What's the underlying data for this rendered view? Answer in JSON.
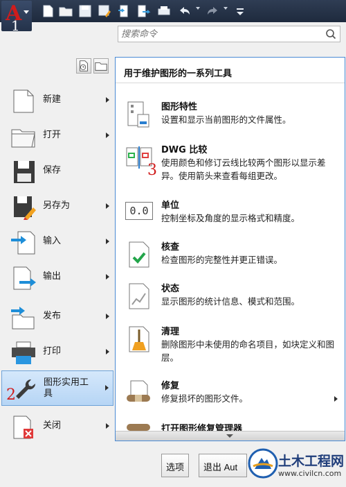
{
  "app_button": {
    "marker": "1"
  },
  "search": {
    "placeholder": "搜索命令"
  },
  "menu": {
    "items": [
      {
        "label": "新建",
        "has_arrow": true
      },
      {
        "label": "打开",
        "has_arrow": true
      },
      {
        "label": "保存",
        "has_arrow": false
      },
      {
        "label": "另存为",
        "has_arrow": true
      },
      {
        "label": "输入",
        "has_arrow": true
      },
      {
        "label": "输出",
        "has_arrow": true
      },
      {
        "label": "发布",
        "has_arrow": true
      },
      {
        "label": "打印",
        "has_arrow": true
      },
      {
        "label": "图形实用工具",
        "label_line1": "图形实用工",
        "label_line2": "具",
        "has_arrow": true,
        "active": true,
        "marker": "2"
      },
      {
        "label": "关闭",
        "has_arrow": true
      }
    ]
  },
  "submenu": {
    "title": "用于维护图形的一系列工具",
    "items": [
      {
        "title": "图形特性",
        "desc": "设置和显示当前图形的文件属性。"
      },
      {
        "title": "DWG 比较",
        "desc": "使用颜色和修订云线比较两个图形以显示差异。使用箭头来查看每组更改。",
        "marker": "3"
      },
      {
        "title": "单位",
        "desc": "控制坐标及角度的显示格式和精度。",
        "icon_text": "0.0"
      },
      {
        "title": "核查",
        "desc": "检查图形的完整性并更正错误。"
      },
      {
        "title": "状态",
        "desc": "显示图形的统计信息、模式和范围。"
      },
      {
        "title": "清理",
        "desc": "删除图形中未使用的命名项目，如块定义和图层。"
      },
      {
        "title": "修复",
        "desc": "修复损坏的图形文件。",
        "has_arrow": true
      },
      {
        "title": "打开图形修复管理器",
        "desc": ""
      }
    ]
  },
  "buttons": {
    "options": "选项",
    "exit": "退出 Aut"
  },
  "watermark": {
    "title": "土木工程网",
    "url": "www.civilcn.com"
  }
}
